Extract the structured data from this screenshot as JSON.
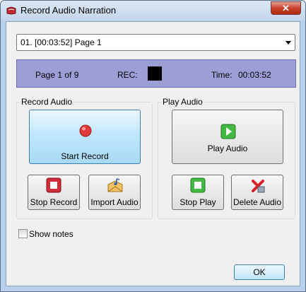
{
  "window": {
    "title": "Record Audio Narration",
    "close_glyph": "✕"
  },
  "page_select": {
    "value": "01. [00:03:52] Page 1"
  },
  "status": {
    "page_info": "Page 1 of 9",
    "rec_label": "REC:",
    "time_label": "Time:",
    "time_value": "00:03:52"
  },
  "record_group": {
    "title": "Record Audio",
    "start_label": "Start Record",
    "stop_label": "Stop Record",
    "import_label": "Import Audio"
  },
  "play_group": {
    "title": "Play Audio",
    "play_label": "Play Audio",
    "stop_label": "Stop Play",
    "delete_label": "Delete Audio"
  },
  "show_notes": {
    "label": "Show notes",
    "checked": false
  },
  "ok_label": "OK",
  "icons": {
    "app": "red-book-icon",
    "record": "red-dot-icon",
    "stop_record": "red-stop-icon",
    "import": "import-audio-icon",
    "play": "green-play-icon",
    "stop_play": "green-stop-icon",
    "delete": "red-x-icon"
  },
  "colors": {
    "status_bg": "#9e9ed6",
    "record": "#e03030",
    "play": "#3cb33c",
    "active_button": "#bee6fd"
  }
}
